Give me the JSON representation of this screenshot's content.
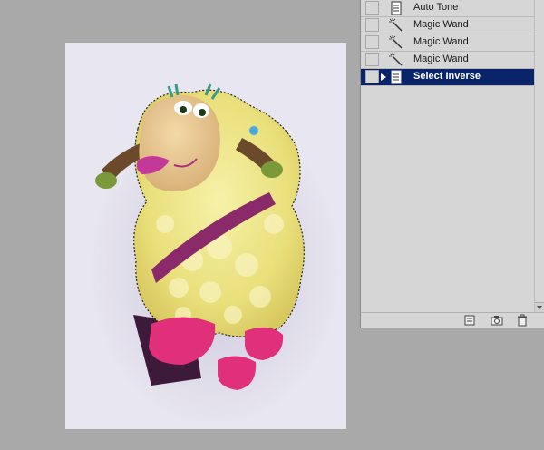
{
  "history": {
    "items": [
      {
        "label": "Auto Tone",
        "icon": "document-icon",
        "active": false
      },
      {
        "label": "Magic Wand",
        "icon": "magic-wand-icon",
        "active": false
      },
      {
        "label": "Magic Wand",
        "icon": "magic-wand-icon",
        "active": false
      },
      {
        "label": "Magic Wand",
        "icon": "magic-wand-icon",
        "active": false
      },
      {
        "label": "Select Inverse",
        "icon": "document-icon",
        "active": true
      }
    ],
    "footer": [
      "new-document-from-state-icon",
      "camera-icon",
      "trash-icon"
    ]
  },
  "colors": {
    "highlight": "#0a246a",
    "workspace": "#a9a9a9",
    "panel": "#d6d6d6"
  }
}
